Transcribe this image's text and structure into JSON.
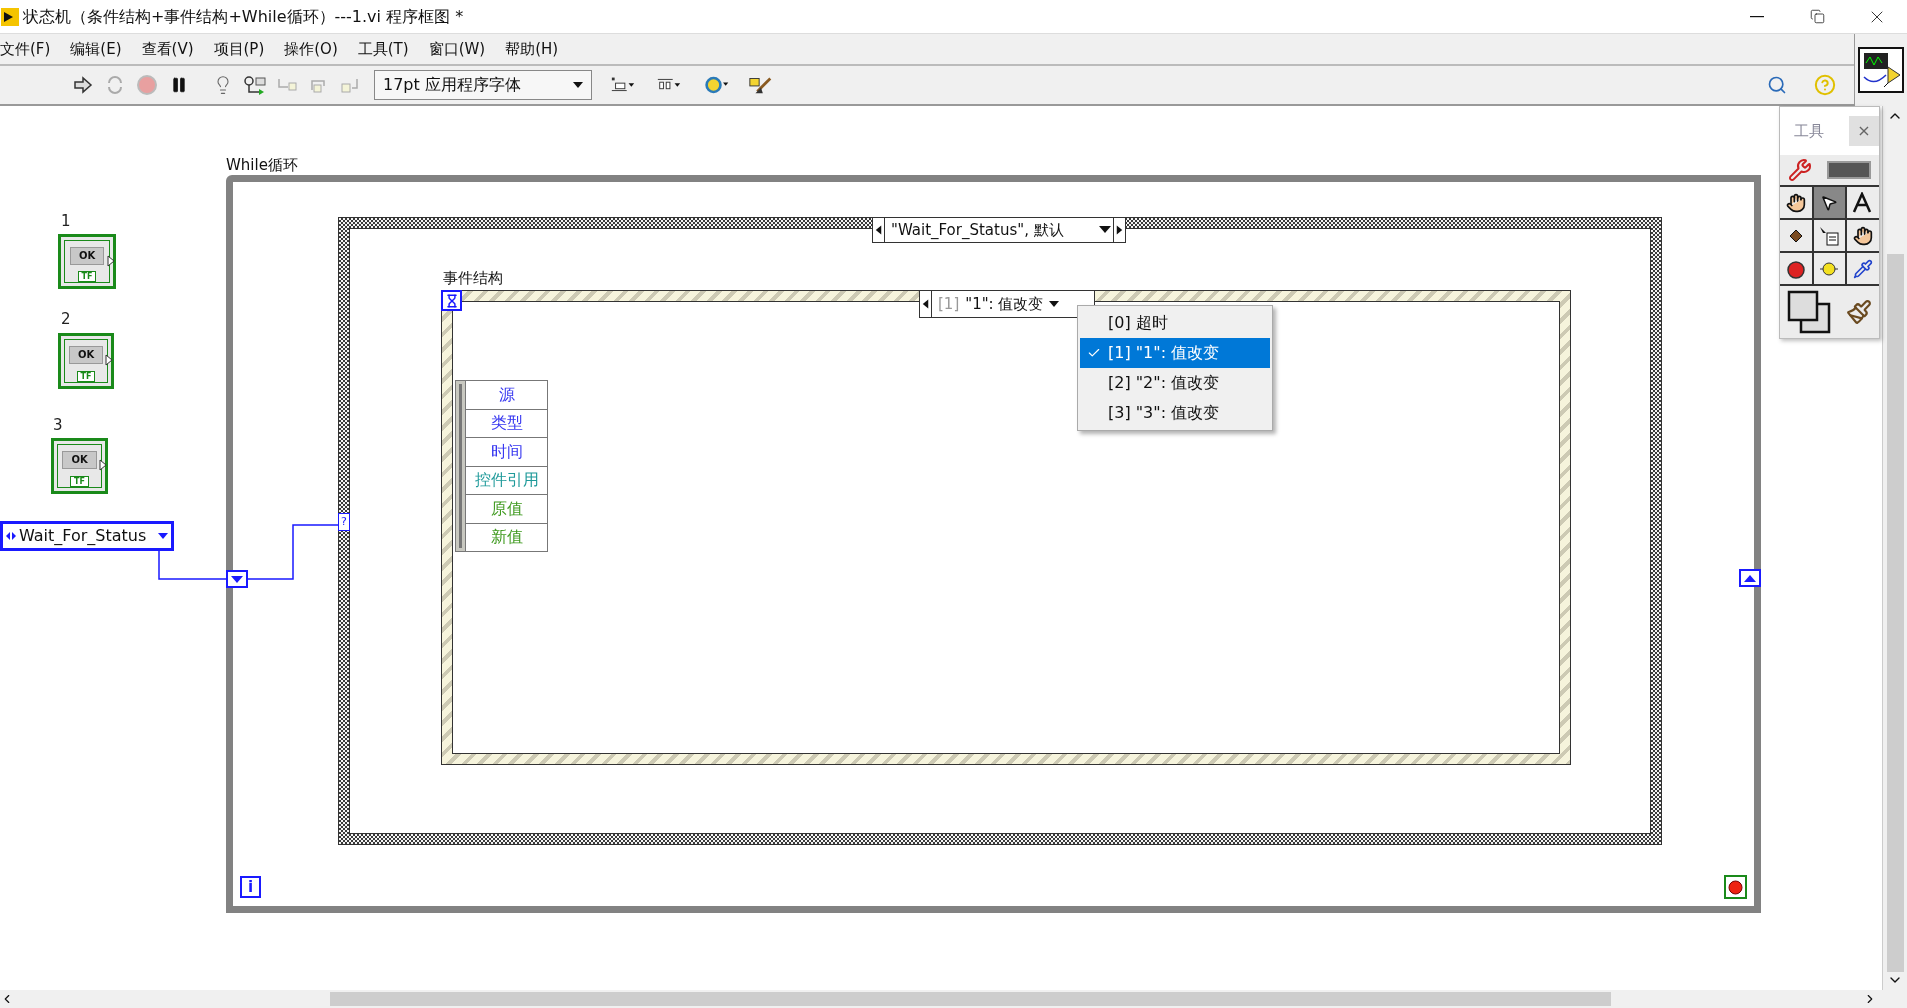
{
  "window": {
    "title": "状态机（条件结构+事件结构+While循环）---1.vi 程序框图 *"
  },
  "menu": [
    "文件(F)",
    "编辑(E)",
    "查看(V)",
    "项目(P)",
    "操作(O)",
    "工具(T)",
    "窗口(W)",
    "帮助(H)"
  ],
  "toolbar": {
    "font": "17pt 应用程序字体"
  },
  "controls": [
    {
      "label": "1",
      "button": "OK",
      "type": "TF"
    },
    {
      "label": "2",
      "button": "OK",
      "type": "TF"
    },
    {
      "label": "3",
      "button": "OK",
      "type": "TF"
    }
  ],
  "enum_constant": {
    "value": "Wait_For_Status"
  },
  "while_loop": {
    "label": "While循环",
    "iteration": "i"
  },
  "case_structure": {
    "selector": "\"Wait_For_Status\", 默认",
    "terminal": "?"
  },
  "event_structure": {
    "label": "事件结构",
    "selector": {
      "index": "[1]",
      "name": "\"1\": 值改变"
    },
    "menu": [
      {
        "text": "[0] 超时",
        "selected": false
      },
      {
        "text": "[1] \"1\": 值改变",
        "selected": true
      },
      {
        "text": "[2] \"2\": 值改变",
        "selected": false
      },
      {
        "text": "[3] \"3\": 值改变",
        "selected": false
      }
    ],
    "data_node": [
      {
        "text": "源",
        "color": "#3535f0"
      },
      {
        "text": "类型",
        "color": "#3535f0"
      },
      {
        "text": "时间",
        "color": "#3535f0"
      },
      {
        "text": "控件引用",
        "color": "#1f9a9a"
      },
      {
        "text": "原值",
        "color": "#3f9a1f"
      },
      {
        "text": "新值",
        "color": "#3f9a1f"
      }
    ]
  },
  "tools_palette": {
    "title": "工具",
    "close": "×"
  }
}
